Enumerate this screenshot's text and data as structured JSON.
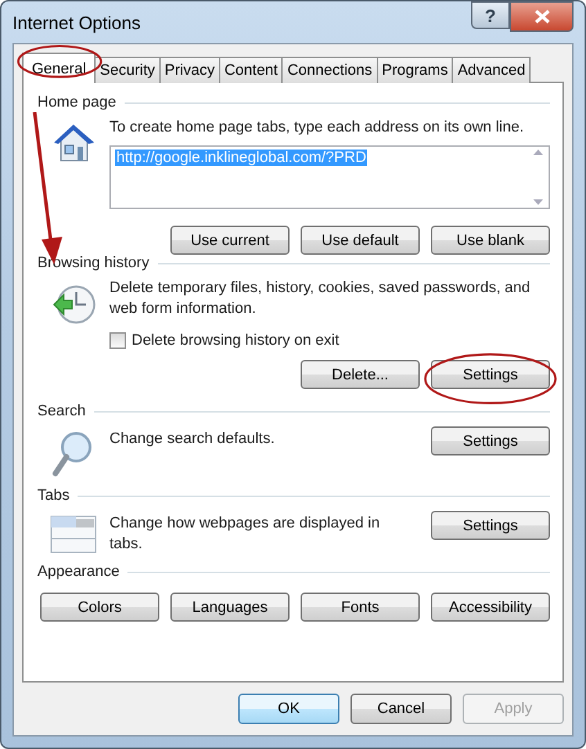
{
  "window": {
    "title": "Internet Options",
    "help_button": "?"
  },
  "tabs": [
    {
      "label": "General",
      "selected": true,
      "annotated": true
    },
    {
      "label": "Security",
      "selected": false,
      "annotated": false
    },
    {
      "label": "Privacy",
      "selected": false,
      "annotated": false
    },
    {
      "label": "Content",
      "selected": false,
      "annotated": false
    },
    {
      "label": "Connections",
      "selected": false,
      "annotated": false
    },
    {
      "label": "Programs",
      "selected": false,
      "annotated": false
    },
    {
      "label": "Advanced",
      "selected": false,
      "annotated": false
    }
  ],
  "sections": [
    {
      "kind": "home",
      "title": "Home page",
      "description": "To create home page tabs, type each address on its own line.",
      "url": {
        "value": "http://google.inklineglobal.com/?PRD",
        "selected": true
      },
      "buttons": [
        {
          "label": "Use current",
          "annotated": false
        },
        {
          "label": "Use default",
          "annotated": false
        },
        {
          "label": "Use blank",
          "annotated": false
        }
      ]
    },
    {
      "kind": "history",
      "title": "Browsing history",
      "description": "Delete temporary files, history, cookies, saved passwords, and web form information.",
      "checkbox": {
        "label": "Delete browsing history on exit",
        "checked": false
      },
      "buttons": [
        {
          "label": "Delete...",
          "annotated": false
        },
        {
          "label": "Settings",
          "annotated": true
        }
      ]
    },
    {
      "kind": "search",
      "title": "Search",
      "description": "Change search defaults.",
      "buttons": [
        {
          "label": "Settings",
          "annotated": false
        }
      ]
    },
    {
      "kind": "tabs",
      "title": "Tabs",
      "description": "Change how webpages are displayed in tabs.",
      "buttons": [
        {
          "label": "Settings",
          "annotated": false
        }
      ]
    },
    {
      "kind": "appearance",
      "title": "Appearance",
      "buttons": [
        {
          "label": "Colors",
          "annotated": false
        },
        {
          "label": "Languages",
          "annotated": false
        },
        {
          "label": "Fonts",
          "annotated": false
        },
        {
          "label": "Accessibility",
          "annotated": false
        }
      ]
    }
  ],
  "footer_buttons": [
    {
      "label": "OK",
      "default": true,
      "disabled": false
    },
    {
      "label": "Cancel",
      "default": false,
      "disabled": false
    },
    {
      "label": "Apply",
      "default": false,
      "disabled": true
    }
  ]
}
